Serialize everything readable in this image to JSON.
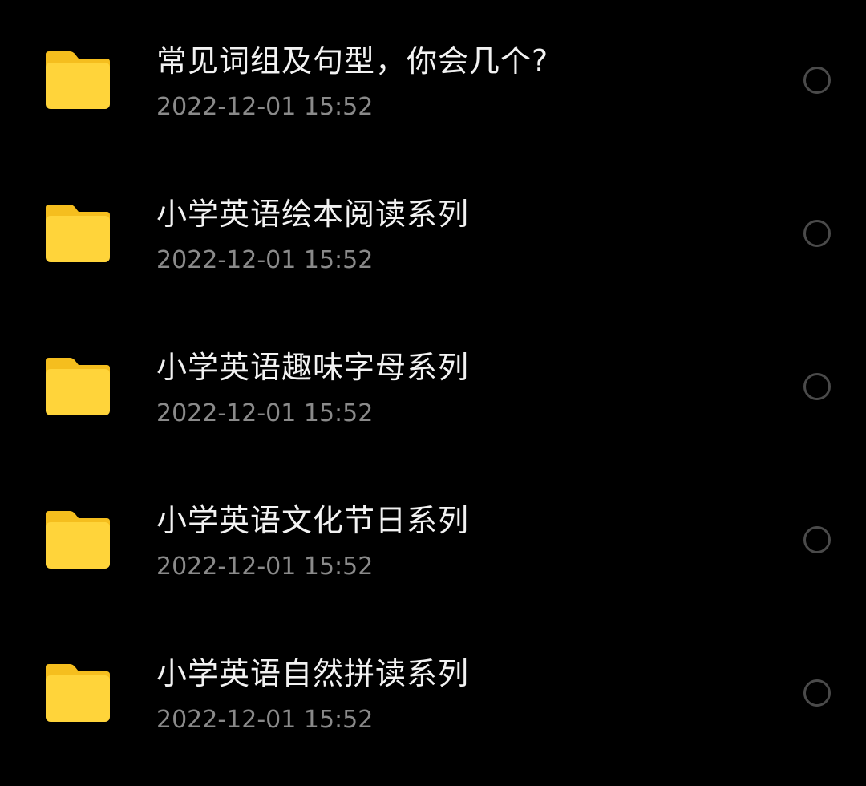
{
  "files": [
    {
      "name": "常见词组及句型，你会几个?",
      "date": "2022-12-01 15:52",
      "icon": "folder-icon"
    },
    {
      "name": "小学英语绘本阅读系列",
      "date": "2022-12-01 15:52",
      "icon": "folder-icon"
    },
    {
      "name": "小学英语趣味字母系列",
      "date": "2022-12-01 15:52",
      "icon": "folder-icon"
    },
    {
      "name": "小学英语文化节日系列",
      "date": "2022-12-01 15:52",
      "icon": "folder-icon"
    },
    {
      "name": "小学英语自然拼读系列",
      "date": "2022-12-01 15:52",
      "icon": "folder-icon"
    }
  ],
  "colors": {
    "background": "#000000",
    "folder_fill": "#FFD43A",
    "folder_tab": "#F5BE1E",
    "title_text": "#F2F2F2",
    "date_text": "#8A8A8A",
    "radio_border": "#4A4A4A"
  }
}
